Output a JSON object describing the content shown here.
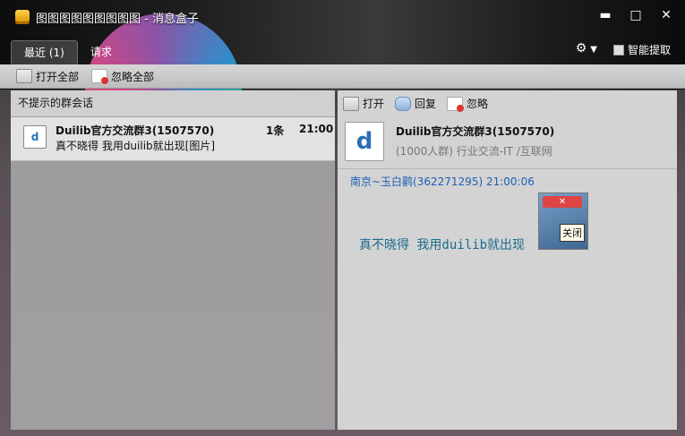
{
  "window": {
    "title": "图图图图图图图图图 - 消息盒子",
    "controls": {
      "minimize": "▬",
      "maximize": "□",
      "close": "✕"
    }
  },
  "tabs": [
    {
      "label": "最近 (1)",
      "active": true
    },
    {
      "label": "请求",
      "active": false
    }
  ],
  "header_right": {
    "settings_icon": "gear-icon",
    "smart_label": "智能提取",
    "smart_checked": false
  },
  "toolbar": {
    "open_all": "打开全部",
    "ignore_all": "忽略全部"
  },
  "left": {
    "section_title": "不提示的群会话",
    "conversation": {
      "name": "Duilib官方交流群3(1507570)",
      "message": "真不晓得 我用duilib就出现[图片]",
      "count": "1条",
      "time": "21:00",
      "avatar_text": "d"
    }
  },
  "right": {
    "toolbar": {
      "open": "打开",
      "reply": "回复",
      "ignore": "忽略"
    },
    "group": {
      "name": "Duilib官方交流群3(1507570)",
      "meta": "(1000人群) 行业交流-IT /互联网",
      "avatar_text": "d"
    },
    "sender_line": "南京~玉白鹳(362271295) 21:00:06",
    "message_text": "真不晓得 我用duilib就出现",
    "image_tooltip": "关闭"
  }
}
